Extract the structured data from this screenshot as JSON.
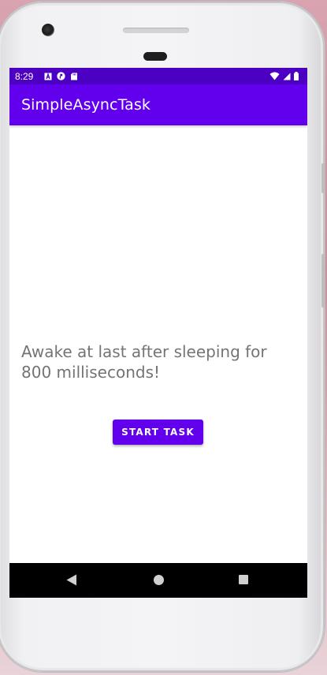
{
  "status_bar": {
    "time": "8:29",
    "left_icons": [
      "a-notification-icon",
      "pinwheel-icon",
      "sd-card-icon"
    ],
    "right_icons": [
      "wifi-icon",
      "signal-icon",
      "battery-icon"
    ]
  },
  "app_bar": {
    "title": "SimpleAsyncTask",
    "color": "#6200ee",
    "status_color": "#4b00c2"
  },
  "main": {
    "message": "Awake at last after sleeping for 800 milliseconds!",
    "start_button_label": "START TASK"
  },
  "nav_bar": {
    "icons": [
      "back-icon",
      "home-icon",
      "recents-icon"
    ]
  }
}
